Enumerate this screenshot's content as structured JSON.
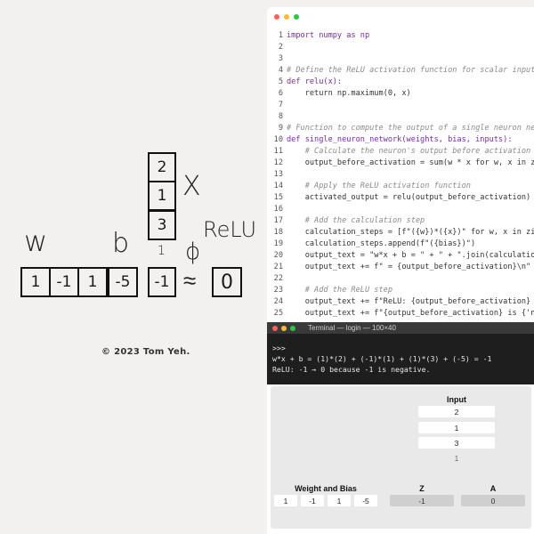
{
  "sketch": {
    "w_label": "w",
    "b_label": "b",
    "x_label": "X",
    "relu_label": "ReLU",
    "phi_label": "ϕ",
    "approx_label": "≈",
    "weights": [
      "1",
      "-1",
      "1"
    ],
    "bias": "-5",
    "inputs": [
      "2",
      "1",
      "3"
    ],
    "bias_input": "1",
    "z": "-1",
    "a": "0",
    "copyright": "© 2023 Tom Yeh."
  },
  "editor": {
    "dot_colors": [
      "#ff5f57",
      "#febc2e",
      "#28c840"
    ],
    "lines": [
      {
        "n": "1",
        "t": "import numpy as np"
      },
      {
        "n": "2",
        "t": ""
      },
      {
        "n": "3",
        "t": ""
      },
      {
        "n": "4",
        "t": "# Define the ReLU activation function for scalar inputs"
      },
      {
        "n": "5",
        "t": "def relu(x):"
      },
      {
        "n": "6",
        "t": "    return np.maximum(0, x)"
      },
      {
        "n": "7",
        "t": ""
      },
      {
        "n": "8",
        "t": ""
      },
      {
        "n": "9",
        "t": "# Function to compute the output of a single neuron net"
      },
      {
        "n": "10",
        "t": "def single_neuron_network(weights, bias, inputs):"
      },
      {
        "n": "11",
        "t": "    # Calculate the neuron's output before activation"
      },
      {
        "n": "12",
        "t": "    output_before_activation = sum(w * x for w, x in zi"
      },
      {
        "n": "13",
        "t": ""
      },
      {
        "n": "14",
        "t": "    # Apply the ReLU activation function"
      },
      {
        "n": "15",
        "t": "    activated_output = relu(output_before_activation)"
      },
      {
        "n": "16",
        "t": ""
      },
      {
        "n": "17",
        "t": "    # Add the calculation step"
      },
      {
        "n": "18",
        "t": "    calculation_steps = [f\"({w})*({x})\" for w, x in zip"
      },
      {
        "n": "19",
        "t": "    calculation_steps.append(f\"({bias})\")"
      },
      {
        "n": "20",
        "t": "    output_text = \"w*x + b = \" + \" + \".join(calculation"
      },
      {
        "n": "21",
        "t": "    output_text += f\" = {output_before_activation}\\n\""
      },
      {
        "n": "22",
        "t": ""
      },
      {
        "n": "23",
        "t": "    # Add the ReLU step"
      },
      {
        "n": "24",
        "t": "    output_text += f\"ReLU: {output_before_activation} →"
      },
      {
        "n": "25",
        "t": "    output_text += f\"{output_before_activation} is {'ne"
      }
    ]
  },
  "terminal": {
    "title": "Terminal — login — 100×40",
    "dot_colors": [
      "#ff5f57",
      "#febc2e",
      "#28c840"
    ],
    "prompt": ">>>",
    "line1": "w*x + b = (1)*(2) + (-1)*(1) + (1)*(3) + (-5) = -1",
    "line2": "ReLU: -1 → 0 because -1 is negative."
  },
  "panel": {
    "input_header": "Input",
    "inputs": [
      "2",
      "1",
      "3"
    ],
    "bias_input": "1",
    "weight_header": "Weight and Bias",
    "weights": [
      "1",
      "-1",
      "1",
      "-5"
    ],
    "z_header": "Z",
    "z_value": "-1",
    "a_header": "A",
    "a_value": "0"
  }
}
